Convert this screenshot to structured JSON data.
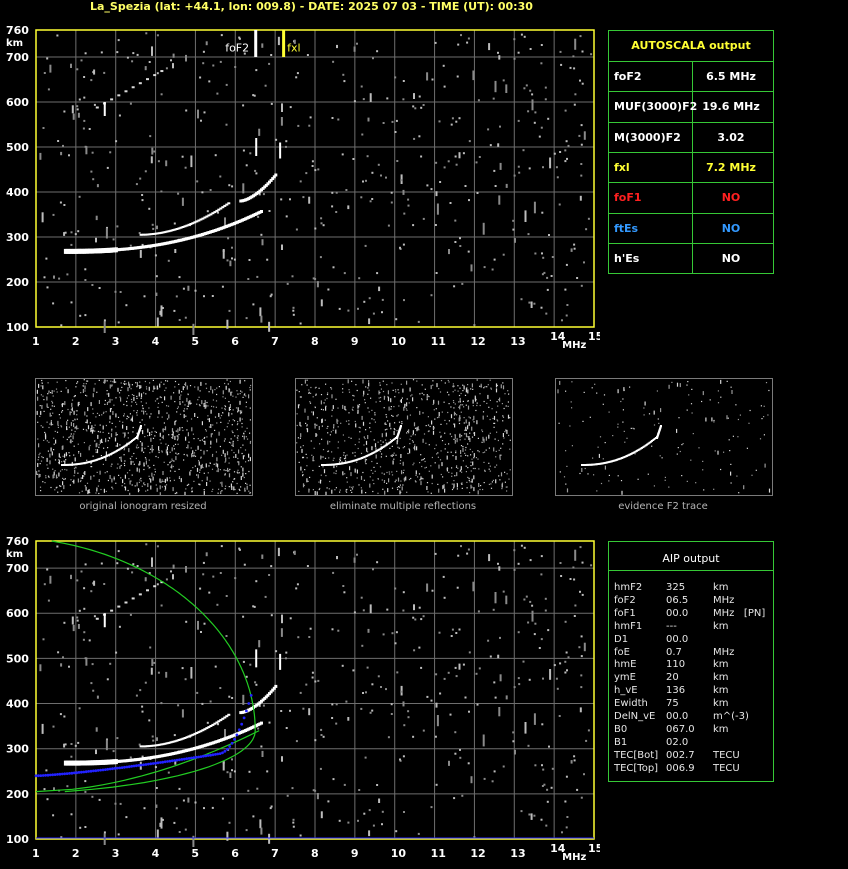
{
  "header": {
    "title": "La_Spezia (lat: +44.1, lon: 009.8) - DATE: 2025 07 03 - TIME (UT): 00:30"
  },
  "colors": {
    "accent_yellow": "#ffff33",
    "panel_border": "#36c836",
    "grid": "#707070",
    "foF1_red": "#ff2020",
    "ftEs_blue": "#3399ff",
    "profile_green": "#22cc22",
    "trace_blue": "#2222ff"
  },
  "axes": {
    "km_label": "km",
    "mhz_label": "MHz",
    "y_ticks": [
      "760",
      "700",
      "600",
      "500",
      "400",
      "300",
      "200",
      "100"
    ],
    "x_ticks": [
      "1",
      "2",
      "3",
      "4",
      "5",
      "6",
      "7",
      "8",
      "9",
      "10",
      "11",
      "12",
      "13",
      "14",
      "15"
    ]
  },
  "top_plot": {
    "marker_foF2_label": "foF2",
    "marker_fxl_label": "fxl",
    "marker_foF2_mhz": 6.5,
    "marker_fxl_mhz": 7.2
  },
  "autoscala": {
    "title": "AUTOSCALA output",
    "rows": [
      {
        "label": "foF2",
        "value": "6.5 MHz",
        "color": "#ffffff"
      },
      {
        "label": "MUF(3000)F2",
        "value": "19.6 MHz",
        "color": "#ffffff"
      },
      {
        "label": "M(3000)F2",
        "value": "3.02",
        "color": "#ffffff"
      },
      {
        "label": "fxl",
        "value": "7.2 MHz",
        "color": "#ffff33"
      },
      {
        "label": "foF1",
        "value": "NO",
        "color": "#ff2020"
      },
      {
        "label": "ftEs",
        "value": "NO",
        "color": "#3399ff"
      },
      {
        "label": "h'Es",
        "value": "NO",
        "color": "#ffffff"
      }
    ]
  },
  "thumbnails": [
    {
      "caption": "original ionogram resized"
    },
    {
      "caption": "eliminate multiple reflections"
    },
    {
      "caption": "evidence F2 trace"
    }
  ],
  "aip": {
    "title": "AIP output",
    "rows": [
      {
        "label": "hmF2",
        "value": "325",
        "unit": "km"
      },
      {
        "label": "foF2",
        "value": "06.5",
        "unit": "MHz"
      },
      {
        "label": "foF1",
        "value": "00.0",
        "unit": "MHz   [PN]"
      },
      {
        "label": "hmF1",
        "value": "---",
        "unit": "km"
      },
      {
        "label": "D1",
        "value": "00.0",
        "unit": ""
      },
      {
        "label": "foE",
        "value": "0.7",
        "unit": "MHz"
      },
      {
        "label": "hmE",
        "value": "110",
        "unit": "km"
      },
      {
        "label": "ymE",
        "value": "20",
        "unit": "km"
      },
      {
        "label": "h_vE",
        "value": "136",
        "unit": "km"
      },
      {
        "label": "Ewidth",
        "value": "75",
        "unit": "km"
      },
      {
        "label": "DelN_vE",
        "value": "00.0",
        "unit": "m^(-3)"
      },
      {
        "label": "B0",
        "value": "067.0",
        "unit": "km"
      },
      {
        "label": "B1",
        "value": "02.0",
        "unit": ""
      },
      {
        "label": "TEC[Bot]",
        "value": "002.7",
        "unit": "TECU"
      },
      {
        "label": "TEC[Top]",
        "value": "006.9",
        "unit": "TECU"
      }
    ]
  }
}
